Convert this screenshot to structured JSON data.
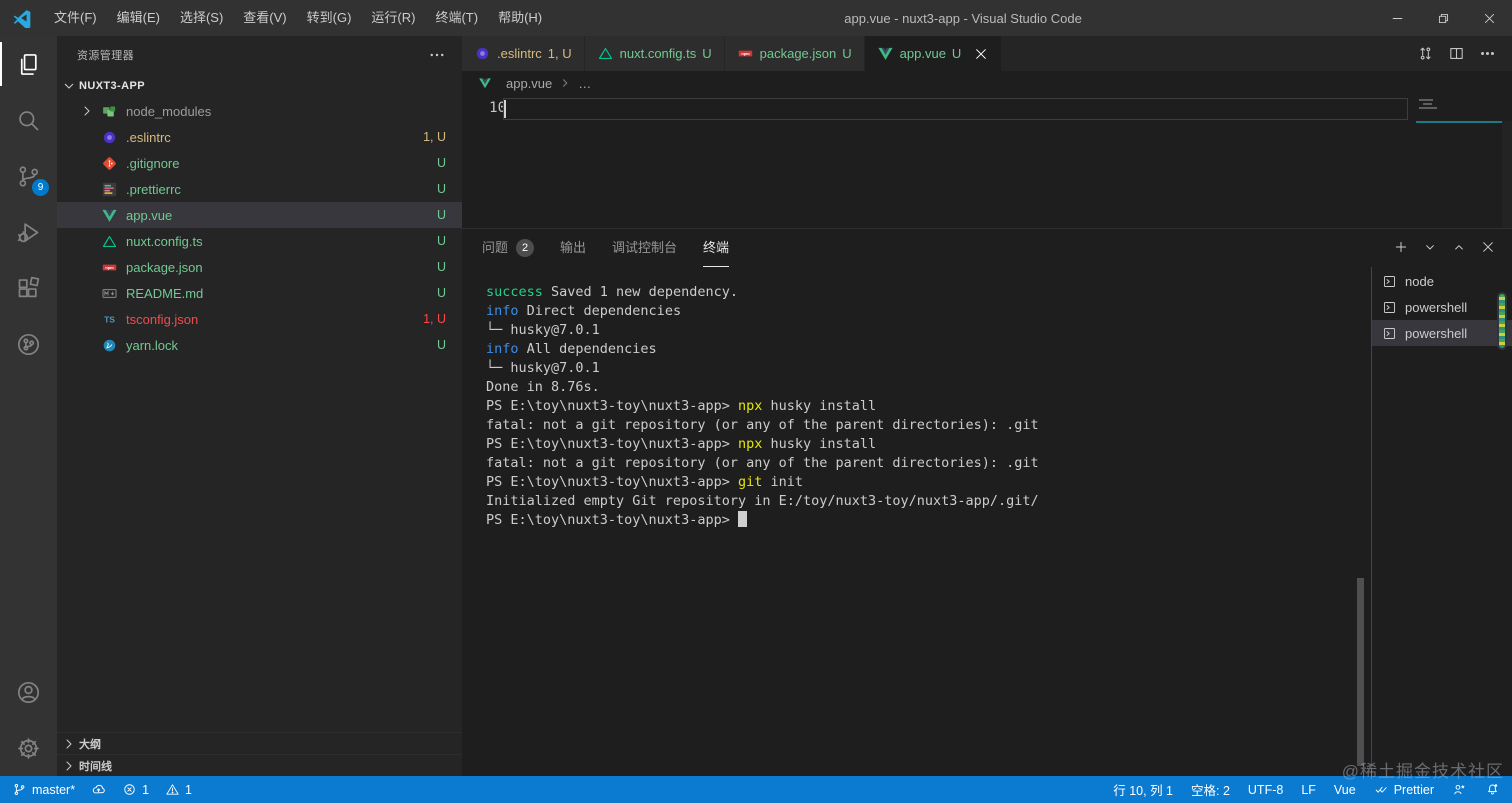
{
  "title_bar": {
    "title": "app.vue - nuxt3-app - Visual Studio Code",
    "menus": [
      "文件(F)",
      "编辑(E)",
      "选择(S)",
      "查看(V)",
      "转到(G)",
      "运行(R)",
      "终端(T)",
      "帮助(H)"
    ],
    "window_controls": [
      "minimize",
      "restore",
      "close"
    ]
  },
  "activity_bar": {
    "items": [
      {
        "icon": "explorer",
        "active": true
      },
      {
        "icon": "search"
      },
      {
        "icon": "source-control",
        "badge": "9"
      },
      {
        "icon": "run-debug"
      },
      {
        "icon": "extensions"
      },
      {
        "icon": "remote-git"
      }
    ],
    "bottom_items": [
      {
        "icon": "accounts"
      },
      {
        "icon": "settings-gear"
      }
    ]
  },
  "sidebar": {
    "header": "资源管理器",
    "root": "NUXT3-APP",
    "files": [
      {
        "label": "node_modules",
        "badge": "",
        "icon": "node-modules",
        "color": "#9d9d9d",
        "folder": true
      },
      {
        "label": ".eslintrc",
        "badge": "1, U",
        "icon": "eslint",
        "color": "#d7ba7d"
      },
      {
        "label": ".gitignore",
        "badge": "U",
        "icon": "git",
        "color": "#73c991"
      },
      {
        "label": ".prettierrc",
        "badge": "U",
        "icon": "prettier",
        "color": "#73c991"
      },
      {
        "label": "app.vue",
        "badge": "U",
        "icon": "vue",
        "color": "#73c991",
        "selected": true
      },
      {
        "label": "nuxt.config.ts",
        "badge": "U",
        "icon": "nuxt",
        "color": "#73c991"
      },
      {
        "label": "package.json",
        "badge": "U",
        "icon": "npm",
        "color": "#73c991"
      },
      {
        "label": "README.md",
        "badge": "U",
        "icon": "markdown",
        "color": "#73c991"
      },
      {
        "label": "tsconfig.json",
        "badge": "1, U",
        "icon": "typescript",
        "color": "#f14c4c"
      },
      {
        "label": "yarn.lock",
        "badge": "U",
        "icon": "yarn",
        "color": "#73c991"
      }
    ],
    "sections": [
      "大纲",
      "时间线"
    ]
  },
  "editor": {
    "tabs": [
      {
        "label": ".eslintrc",
        "badge": "1, U",
        "icon": "eslint",
        "color": "#d7ba7d"
      },
      {
        "label": "nuxt.config.ts",
        "badge": "U",
        "icon": "nuxt",
        "color": "#73c991"
      },
      {
        "label": "package.json",
        "badge": "U",
        "icon": "npm",
        "color": "#73c991"
      },
      {
        "label": "app.vue",
        "badge": "U",
        "icon": "vue",
        "color": "#73c991",
        "active": true
      }
    ],
    "tab_actions": [
      "compare-changes",
      "split-editor",
      "more-actions"
    ],
    "breadcrumb": {
      "file": "app.vue",
      "ellipsis": "…"
    },
    "line_number": "10"
  },
  "panel": {
    "tabs": [
      {
        "label": "问题",
        "badge": "2"
      },
      {
        "label": "输出"
      },
      {
        "label": "调试控制台"
      },
      {
        "label": "终端",
        "active": true
      }
    ],
    "actions": [
      "plus",
      "chevron-down",
      "chevron-up",
      "close"
    ],
    "terminal_lines": [
      [
        {
          "t": "success",
          "c": "success"
        },
        {
          "t": " Saved 1 new dependency."
        }
      ],
      [
        {
          "t": "info",
          "c": "info"
        },
        {
          "t": " Direct dependencies"
        }
      ],
      [
        {
          "t": "└─ husky@7.0.1"
        }
      ],
      [
        {
          "t": "info",
          "c": "info"
        },
        {
          "t": " All dependencies"
        }
      ],
      [
        {
          "t": "└─ husky@7.0.1"
        }
      ],
      [
        {
          "t": "Done in 8.76s."
        }
      ],
      [
        {
          "t": "PS E:\\toy\\nuxt3-toy\\nuxt3-app> "
        },
        {
          "t": "npx",
          "c": "command"
        },
        {
          "t": " husky install"
        }
      ],
      [
        {
          "t": "fatal: not a git repository (or any of the parent directories): .git"
        }
      ],
      [
        {
          "t": "PS E:\\toy\\nuxt3-toy\\nuxt3-app> "
        },
        {
          "t": "npx",
          "c": "command"
        },
        {
          "t": " husky install"
        }
      ],
      [
        {
          "t": "fatal: not a git repository (or any of the parent directories): .git"
        }
      ],
      [
        {
          "t": "PS E:\\toy\\nuxt3-toy\\nuxt3-app> "
        },
        {
          "t": "git",
          "c": "command"
        },
        {
          "t": " init"
        }
      ],
      [
        {
          "t": "Initialized empty Git repository in E:/toy/nuxt3-toy/nuxt3-app/.git/"
        }
      ],
      [
        {
          "t": "PS E:\\toy\\nuxt3-toy\\nuxt3-app> "
        },
        {
          "t": "",
          "c": "cursor"
        }
      ]
    ],
    "terminals": [
      {
        "label": "node"
      },
      {
        "label": "powershell"
      },
      {
        "label": "powershell",
        "selected": true
      }
    ]
  },
  "status_bar": {
    "left_items": [
      {
        "icon": "git-branch",
        "label": "master*"
      },
      {
        "icon": "cloud-sync",
        "label": ""
      },
      {
        "icon": "error-circle",
        "label": "1"
      },
      {
        "icon": "warning-triangle",
        "label": "1"
      }
    ],
    "right_items": [
      {
        "label": "行 10, 列 1"
      },
      {
        "label": "空格: 2"
      },
      {
        "label": "UTF-8"
      },
      {
        "label": "LF"
      },
      {
        "label": "Vue"
      },
      {
        "icon": "double-check",
        "label": "Prettier"
      },
      {
        "icon": "feedback",
        "label": ""
      },
      {
        "icon": "bell-dot",
        "label": ""
      }
    ]
  },
  "watermark": "@稀土掘金技术社区",
  "colors": {
    "statusbar_blue": "#0b7ad1",
    "badge_blue": "#007acc",
    "untracked_green": "#73c991",
    "warning_yellow": "#d7ba7d",
    "error_red": "#f14c4c",
    "terminal_success": "#23d18b",
    "terminal_info": "#3b8eea",
    "terminal_command": "#e5e510",
    "selection_bg": "#37373d"
  }
}
